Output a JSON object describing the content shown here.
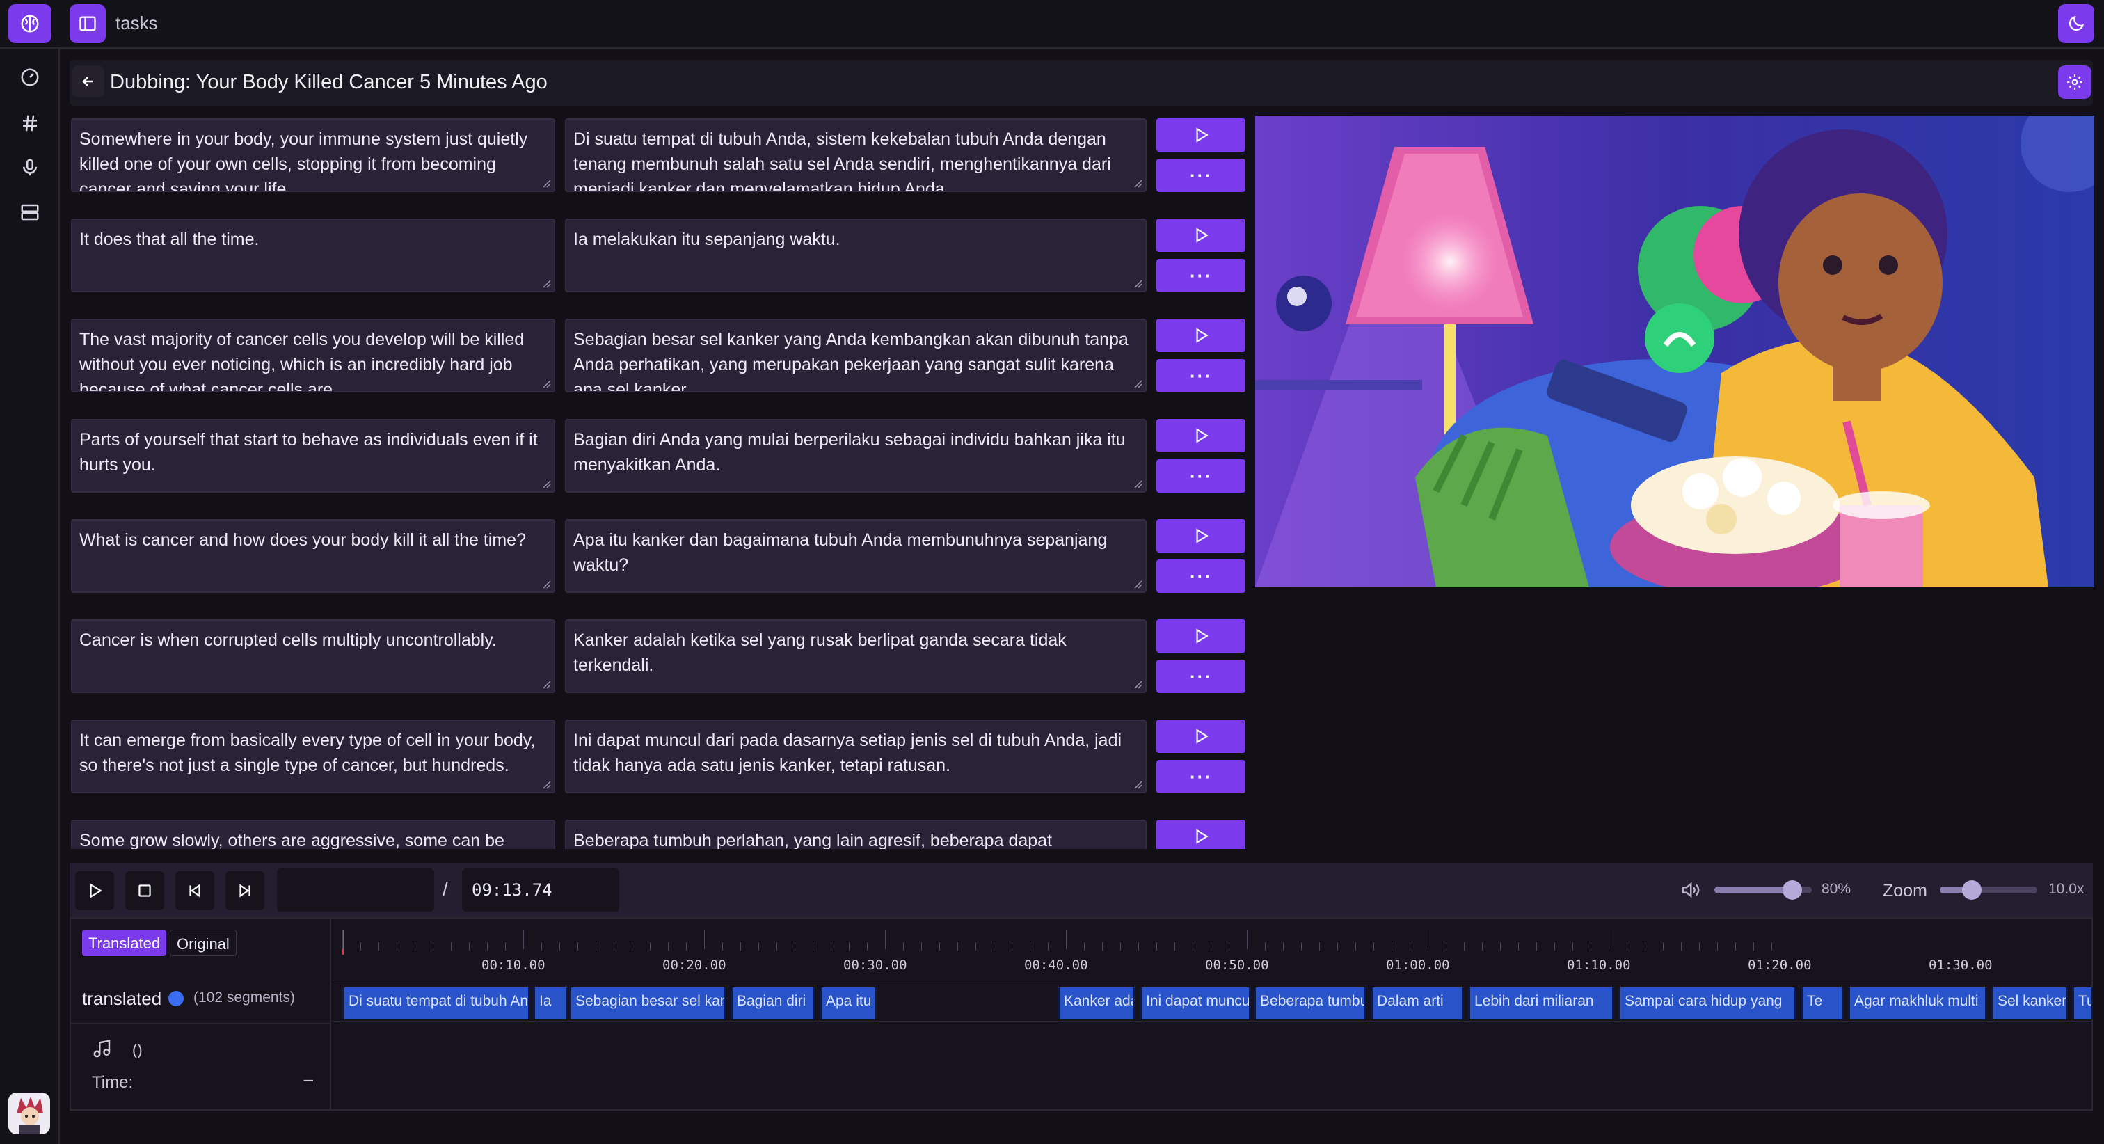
{
  "topbar": {
    "breadcrumb": "tasks"
  },
  "page": {
    "title": "Dubbing: Your Body Killed Cancer 5 Minutes Ago"
  },
  "segments": [
    {
      "original": "Somewhere in your body, your immune system just quietly killed one of your own cells, stopping it from becoming cancer and saving your life.",
      "translated": "Di suatu tempat di tubuh Anda, sistem kekebalan tubuh Anda dengan tenang membunuh salah satu sel Anda sendiri, menghentikannya dari menjadi kanker dan menyelamatkan hidup Anda."
    },
    {
      "original": "It does that all the time.",
      "translated": "Ia melakukan itu sepanjang waktu."
    },
    {
      "original": "The vast majority of cancer cells you develop will be killed without you ever noticing, which is an incredibly hard job because of what cancer cells are.",
      "translated": "Sebagian besar sel kanker yang Anda kembangkan akan dibunuh tanpa Anda perhatikan, yang merupakan pekerjaan yang sangat sulit karena apa sel kanker."
    },
    {
      "original": "Parts of yourself that start to behave as individuals even if it hurts you.",
      "translated": "Bagian diri Anda yang mulai berperilaku sebagai individu bahkan jika itu menyakitkan Anda."
    },
    {
      "original": "What is cancer and how does your body kill it all the time?",
      "translated": "Apa itu kanker dan bagaimana tubuh Anda membunuhnya sepanjang waktu?"
    },
    {
      "original": "Cancer is when corrupted cells multiply uncontrollably.",
      "translated": "Kanker adalah ketika sel yang rusak berlipat ganda secara tidak terkendali."
    },
    {
      "original": "It can emerge from basically every type of cell in your body, so there's not just a single type of cancer, but hundreds.",
      "translated": "Ini dapat muncul dari pada dasarnya setiap jenis sel di tubuh Anda, jadi tidak hanya ada satu jenis kanker, tetapi ratusan."
    },
    {
      "original": "Some grow slowly, others are aggressive, some can be",
      "translated": "Beberapa tumbuh perlahan, yang lain agresif, beberapa dapat"
    }
  ],
  "segment_more_label": "···",
  "transport": {
    "current_time": "",
    "slash": "/",
    "duration": "09:13.74",
    "volume_label": "80%",
    "volume": 0.8,
    "zoom_label": "Zoom",
    "zoom_value": "10.0x",
    "zoom": 0.33
  },
  "timeline": {
    "tabs": {
      "translated": "Translated",
      "original": "Original"
    },
    "track_name": "translated",
    "track_color": "#3b6df0",
    "segment_count": "(102 segments)",
    "ticks": [
      "00:10.00",
      "00:20.00",
      "00:30.00",
      "00:40.00",
      "00:50.00",
      "01:00.00",
      "01:10.00",
      "01:20.00",
      "01:30.00"
    ],
    "clips": [
      {
        "label": "Di suatu tempat di tubuh Anda, sistem"
      },
      {
        "label": "Ia"
      },
      {
        "label": "Sebagian besar sel kanker"
      },
      {
        "label": "Bagian diri"
      },
      {
        "label": "Apa itu"
      },
      {
        "label": "Kanker adalah"
      },
      {
        "label": "Ini dapat muncul"
      },
      {
        "label": "Beberapa tumbuh"
      },
      {
        "label": "Dalam arti"
      },
      {
        "label": "Lebih dari miliaran"
      },
      {
        "label": "Sampai cara hidup yang"
      },
      {
        "label": "Te"
      },
      {
        "label": "Agar makhluk multi"
      },
      {
        "label": "Sel kanker"
      },
      {
        "label": "Tubuh"
      }
    ],
    "info_paren": "()",
    "info_time_label": "Time:",
    "info_time_value": "–"
  }
}
